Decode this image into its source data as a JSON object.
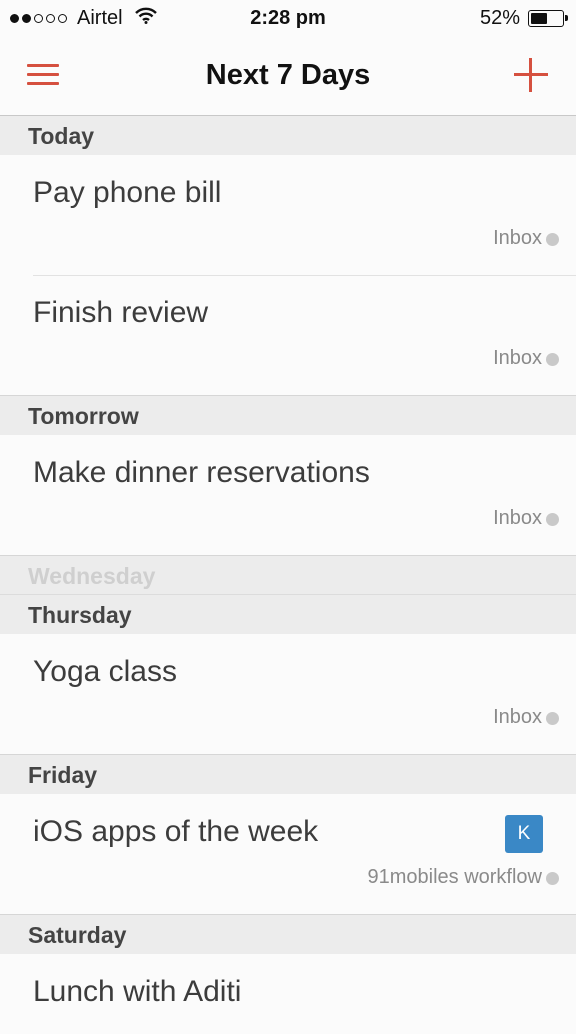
{
  "status_bar": {
    "carrier": "Airtel",
    "time": "2:28 pm",
    "battery": "52%",
    "signal_bars_filled": 2,
    "signal_bars_total": 5
  },
  "nav": {
    "title": "Next 7 Days",
    "menu_icon": "hamburger-menu-icon",
    "add_icon": "plus-icon",
    "accent_color": "#d5503f"
  },
  "sections": {
    "today": {
      "label": "Today",
      "tasks": [
        {
          "title": "Pay phone bill",
          "project": "Inbox"
        },
        {
          "title": "Finish review",
          "project": "Inbox"
        }
      ]
    },
    "tomorrow": {
      "label": "Tomorrow",
      "tasks": [
        {
          "title": "Make dinner reservations",
          "project": "Inbox"
        }
      ]
    },
    "wednesday": {
      "label": "Wednesday"
    },
    "thursday": {
      "label": "Thursday",
      "tasks": [
        {
          "title": "Yoga class",
          "project": "Inbox"
        }
      ]
    },
    "friday": {
      "label": "Friday",
      "tasks": [
        {
          "title": "iOS apps of the week",
          "project": "91mobiles workflow",
          "assignee_initial": "K",
          "assignee_color": "#3a88c6"
        }
      ]
    },
    "saturday": {
      "label": "Saturday",
      "tasks": [
        {
          "title": "Lunch with Aditi"
        }
      ]
    }
  }
}
